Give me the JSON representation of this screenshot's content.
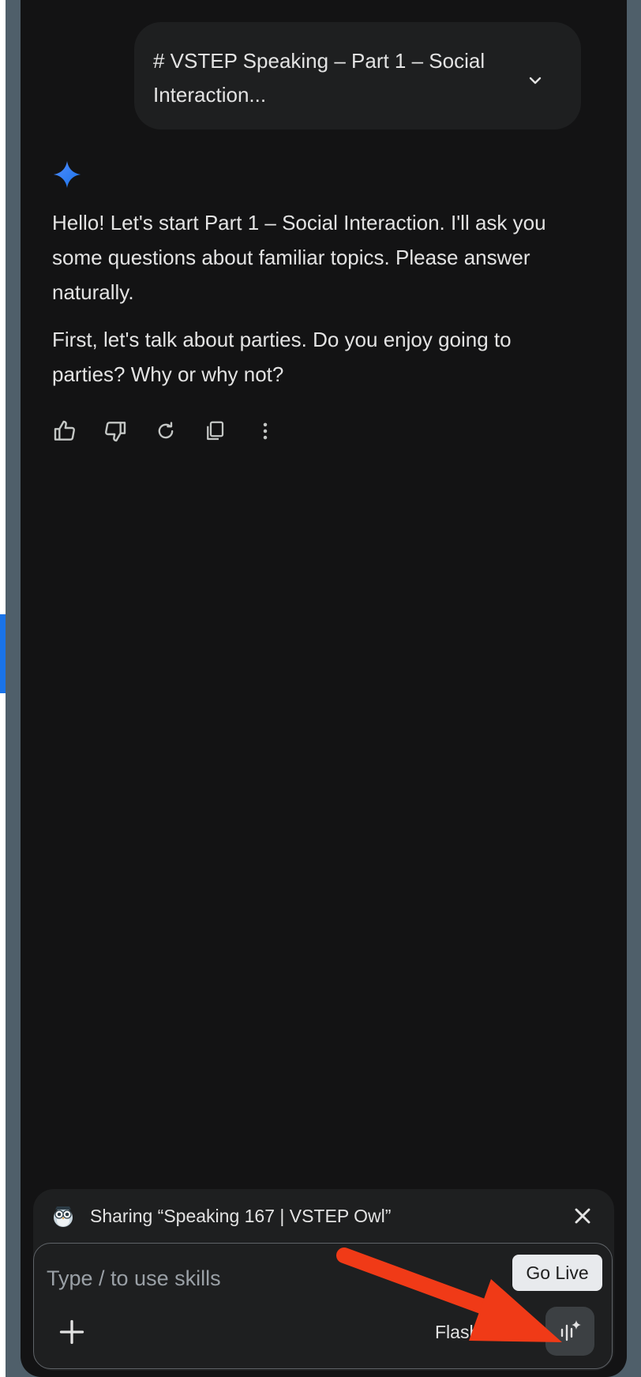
{
  "conversation": {
    "user_prompt_preview": "# VSTEP Speaking – Part 1 – Social Interaction...",
    "reply": {
      "paragraph_1": "Hello! Let's start Part 1 – Social Interaction. I'll ask you some questions about familiar topics. Please answer naturally.",
      "paragraph_2": "First, let's talk about parties. Do you enjoy going to parties? Why or why not?"
    },
    "actions": [
      "thumbs-up-icon",
      "thumbs-down-icon",
      "regenerate-icon",
      "copy-icon",
      "more-options-icon"
    ]
  },
  "composer": {
    "sharing_text": "Sharing “Speaking 167 | VSTEP Owl”",
    "placeholder": "Type / to use skills",
    "go_live_label": "Go Live",
    "model_label": "Flash"
  },
  "colors": {
    "panel_background": "#131314",
    "bubble_background": "#1e1f20",
    "accent_blue": "#4285f4",
    "annotation_arrow": "#f03a17"
  }
}
